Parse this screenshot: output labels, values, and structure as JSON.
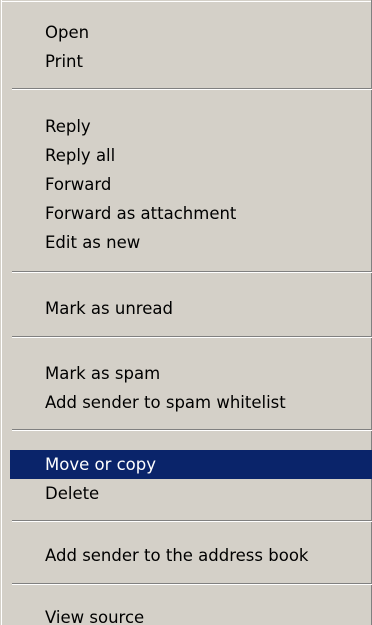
{
  "menu": {
    "items": {
      "open": "Open",
      "print": "Print",
      "reply": "Reply",
      "reply_all": "Reply all",
      "forward": "Forward",
      "forward_attachment": "Forward as attachment",
      "edit_new": "Edit as new",
      "mark_unread": "Mark as unread",
      "mark_spam": "Mark as spam",
      "spam_whitelist": "Add sender to spam whitelist",
      "move_copy": "Move or copy",
      "delete": "Delete",
      "address_book": "Add sender to the address book",
      "view_source": "View source"
    },
    "selected_item": "Move or copy",
    "colors": {
      "menu_background": "#d4d0c8",
      "highlight": "#0a246a",
      "highlight_text": "#ffffff",
      "separator_shadow": "#808080"
    }
  }
}
